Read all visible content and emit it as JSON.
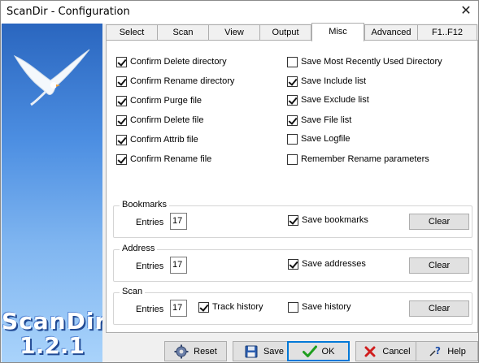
{
  "window": {
    "title": "ScanDir - Configuration",
    "close_glyph": "✕"
  },
  "sidebar": {
    "app_name": "ScanDir",
    "version": "1.2.1",
    "logo_icon": "seagull-icon"
  },
  "tabs": [
    {
      "label": "Select",
      "active": false
    },
    {
      "label": "Scan",
      "active": false
    },
    {
      "label": "View",
      "active": false
    },
    {
      "label": "Output",
      "active": false
    },
    {
      "label": "Misc",
      "active": true
    },
    {
      "label": "Advanced",
      "active": false
    },
    {
      "label": "F1..F12",
      "active": false
    }
  ],
  "misc": {
    "left_options": [
      {
        "label": "Confirm Delete directory",
        "checked": true
      },
      {
        "label": "Confirm Rename directory",
        "checked": true
      },
      {
        "label": "Confirm Purge file",
        "checked": true
      },
      {
        "label": "Confirm Delete file",
        "checked": true
      },
      {
        "label": "Confirm Attrib file",
        "checked": true
      },
      {
        "label": "Confirm Rename file",
        "checked": true
      }
    ],
    "right_options": [
      {
        "label": "Save Most Recently Used Directory",
        "checked": false
      },
      {
        "label": "Save Include list",
        "checked": true
      },
      {
        "label": "Save Exclude list",
        "checked": true
      },
      {
        "label": "Save File list",
        "checked": true
      },
      {
        "label": "Save Logfile",
        "checked": false
      },
      {
        "label": "Remember Rename parameters",
        "checked": false
      }
    ],
    "bookmarks": {
      "legend": "Bookmarks",
      "entries_label": "Entries",
      "entries_value": "17",
      "save_label": "Save bookmarks",
      "save_checked": true,
      "clear_label": "Clear"
    },
    "address": {
      "legend": "Address",
      "entries_label": "Entries",
      "entries_value": "17",
      "save_label": "Save addresses",
      "save_checked": true,
      "clear_label": "Clear"
    },
    "scan": {
      "legend": "Scan",
      "entries_label": "Entries",
      "entries_value": "17",
      "track_label": "Track history",
      "track_checked": true,
      "save_label": "Save history",
      "save_checked": false,
      "clear_label": "Clear"
    }
  },
  "buttons": {
    "reset": "Reset",
    "save": "Save",
    "ok": "OK",
    "cancel": "Cancel",
    "help": "Help"
  },
  "colors": {
    "accent": "#0078d7",
    "ok_check": "#1e9e1e",
    "cancel_x": "#d01e1e"
  }
}
